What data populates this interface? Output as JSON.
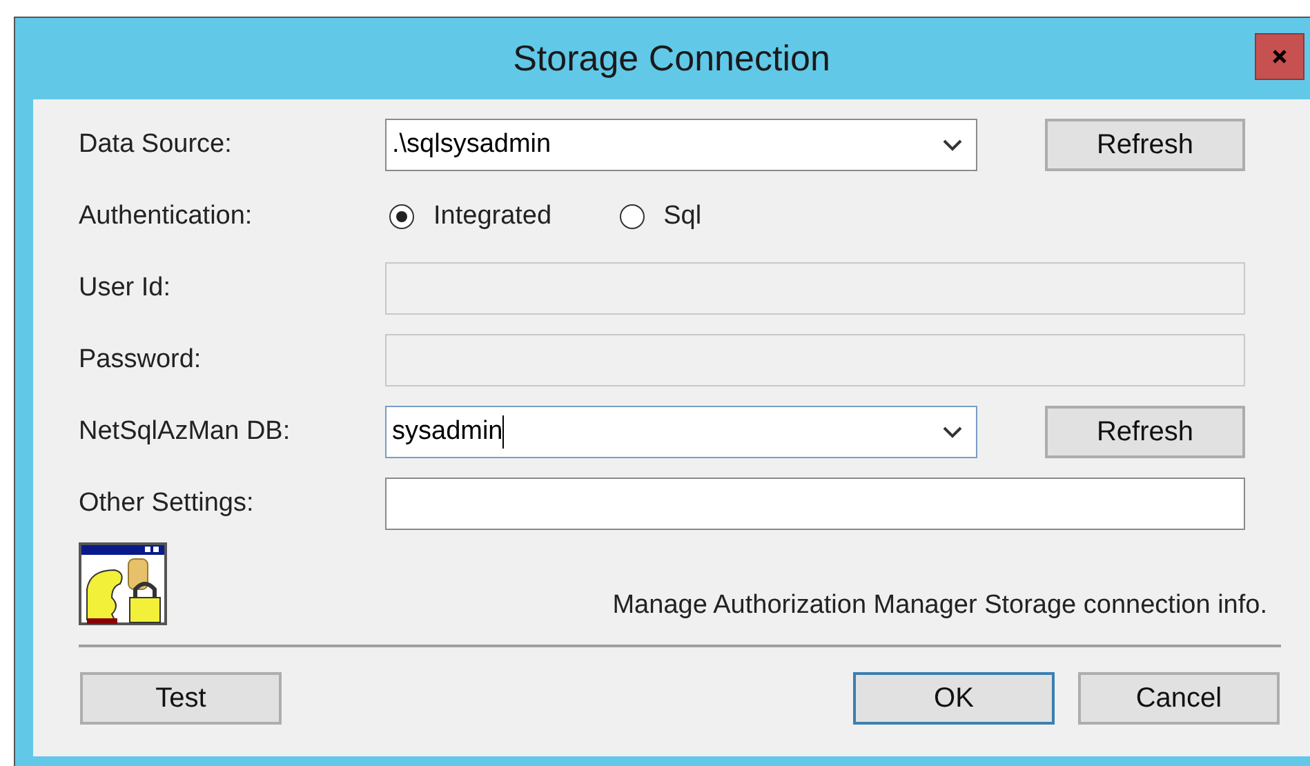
{
  "window": {
    "title": "Storage Connection"
  },
  "fields": [
    {
      "kind": "combo",
      "label": "Data Source:",
      "value": ".\\sqlsysadmin",
      "focused": false,
      "button": "Refresh"
    },
    {
      "kind": "radio",
      "label": "Authentication:",
      "options": [
        {
          "label": "Integrated",
          "selected": true
        },
        {
          "label": "Sql",
          "selected": false
        }
      ]
    },
    {
      "kind": "text",
      "label": "User Id:",
      "disabled": true
    },
    {
      "kind": "text",
      "label": "Password:",
      "disabled": true
    },
    {
      "kind": "combo",
      "label": "NetSqlAzMan DB:",
      "value": "sysadmin",
      "focused": true,
      "button": "Refresh"
    },
    {
      "kind": "text",
      "label": "Other Settings:",
      "disabled": false
    }
  ],
  "info": "Manage Authorization Manager Storage connection info.",
  "buttons": [
    {
      "label": "Test",
      "default": false
    },
    {
      "label": "OK",
      "default": true
    },
    {
      "label": "Cancel",
      "default": false
    }
  ]
}
